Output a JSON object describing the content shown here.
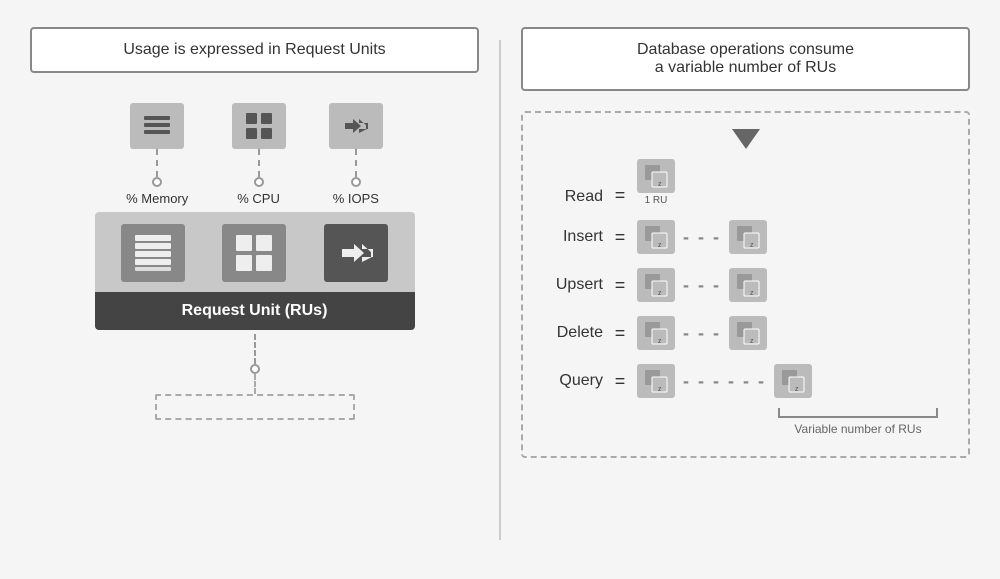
{
  "left_panel": {
    "title": "Usage is expressed in Request Units",
    "labels": {
      "memory": "% Memory",
      "cpu": "% CPU",
      "iops": "% IOPS"
    },
    "ru_label": "Request Unit (RUs)"
  },
  "right_panel": {
    "title_line1": "Database operations consume",
    "title_line2": "a variable number of RUs",
    "operations": [
      {
        "label": "Read",
        "equals": "=",
        "ru_count": 1,
        "ru_text": "1 RU",
        "dashes": ""
      },
      {
        "label": "Insert",
        "equals": "=",
        "dashes": "- - -"
      },
      {
        "label": "Upsert",
        "equals": "=",
        "dashes": "- - -"
      },
      {
        "label": "Delete",
        "equals": "=",
        "dashes": "- - -"
      },
      {
        "label": "Query",
        "equals": "=",
        "dashes": "- - - - - -"
      }
    ],
    "variable_label": "Variable number of RUs"
  }
}
